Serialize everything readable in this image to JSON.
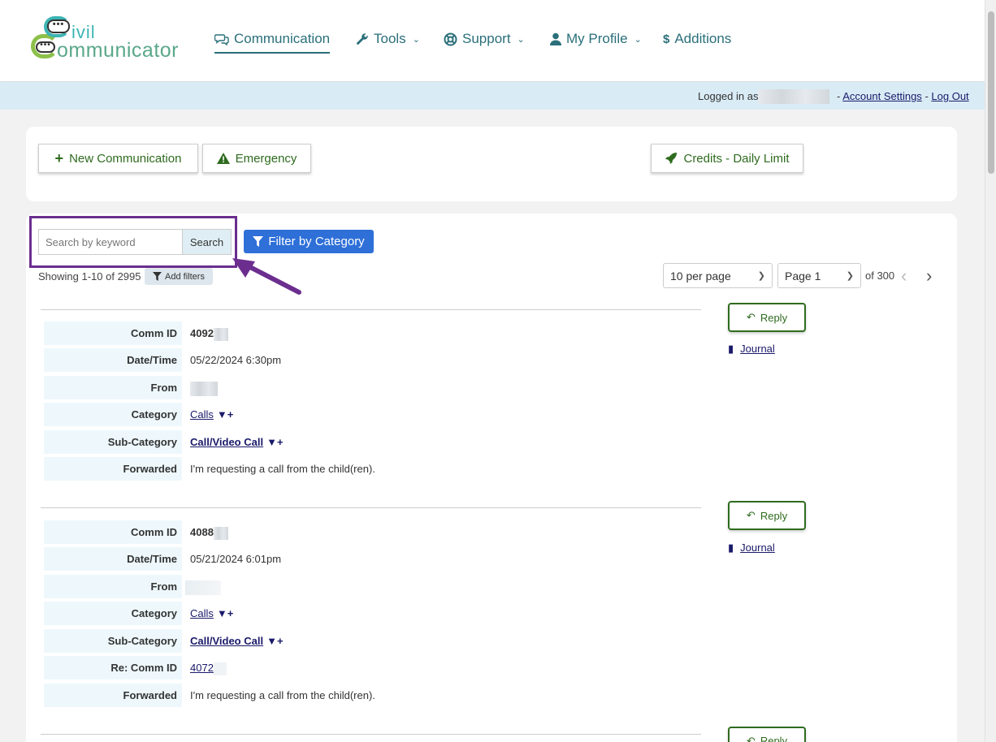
{
  "header": {
    "logo": {
      "line1": "ivil",
      "line2": "ommunicator",
      "dots": "•••"
    },
    "nav": [
      {
        "label": "Communication",
        "icon": "comments-icon"
      },
      {
        "label": "Tools",
        "icon": "wrench-icon"
      },
      {
        "label": "Support",
        "icon": "lifering-icon"
      },
      {
        "label": "My Profile",
        "icon": "user-icon"
      },
      {
        "label": "Additions",
        "icon": "dollar-icon"
      }
    ]
  },
  "subbar": {
    "logged_in": "Logged in as",
    "separator": "-",
    "account_settings": "Account Settings",
    "log_out": "Log Out"
  },
  "actions": {
    "new_communication": "New Communication",
    "emergency": "Emergency",
    "credits": "Credits - Daily Limit"
  },
  "search": {
    "placeholder": "Search by keyword",
    "button": "Search",
    "filter_category": "Filter by Category"
  },
  "listing": {
    "showing": "Showing 1-10 of 2995",
    "add_filters": "Add filters",
    "per_page": "10 per page",
    "page": "Page 1",
    "of_pages": "of 300"
  },
  "labels": {
    "comm_id": "Comm ID",
    "date_time": "Date/Time",
    "from": "From",
    "category": "Category",
    "sub_category": "Sub-Category",
    "re_comm_id": "Re: Comm ID",
    "forwarded": "Forwarded",
    "reply": "Reply",
    "journal": "Journal",
    "reply_partial": "Reply"
  },
  "records": [
    {
      "comm_id": "4092",
      "date_time": "05/22/2024 6:30pm",
      "category": "Calls",
      "sub_category": "Call/Video Call",
      "forwarded": "I'm requesting a call from the child(ren)."
    },
    {
      "comm_id": "4088",
      "date_time": "05/21/2024 6:01pm",
      "category": "Calls",
      "sub_category": "Call/Video Call",
      "re_comm_id": "4072",
      "forwarded": "I'm requesting a call from the child(ren)."
    }
  ],
  "colors": {
    "brand_teal": "#2a6f7a",
    "action_green": "#2e6b1e",
    "primary_blue": "#2e6fd8",
    "highlight_purple": "#6b2e8f",
    "link_navy": "#1a1a6a"
  }
}
